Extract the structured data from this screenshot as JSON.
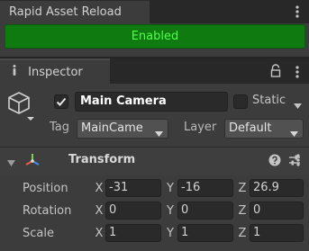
{
  "rapid_asset_reload": {
    "tab_title": "Rapid Asset Reload",
    "status_button": "Enabled",
    "status_color": "#0f7a0f"
  },
  "inspector": {
    "tab_title": "Inspector",
    "tab_icon": "info-icon",
    "game_object": {
      "icon": "cube-icon",
      "active": true,
      "name": "Main Camera",
      "static_label": "Static",
      "static_checked": false,
      "tag_label": "Tag",
      "tag_value": "MainCame",
      "layer_label": "Layer",
      "layer_value": "Default"
    },
    "transform": {
      "title": "Transform",
      "expanded": true,
      "rows": [
        {
          "label": "Position",
          "x": "-31",
          "y": "-16",
          "z": "26.9"
        },
        {
          "label": "Rotation",
          "x": "0",
          "y": "0",
          "z": "0"
        },
        {
          "label": "Scale",
          "x": "1",
          "y": "1",
          "z": "1"
        }
      ],
      "axis_labels": [
        "X",
        "Y",
        "Z"
      ]
    }
  }
}
